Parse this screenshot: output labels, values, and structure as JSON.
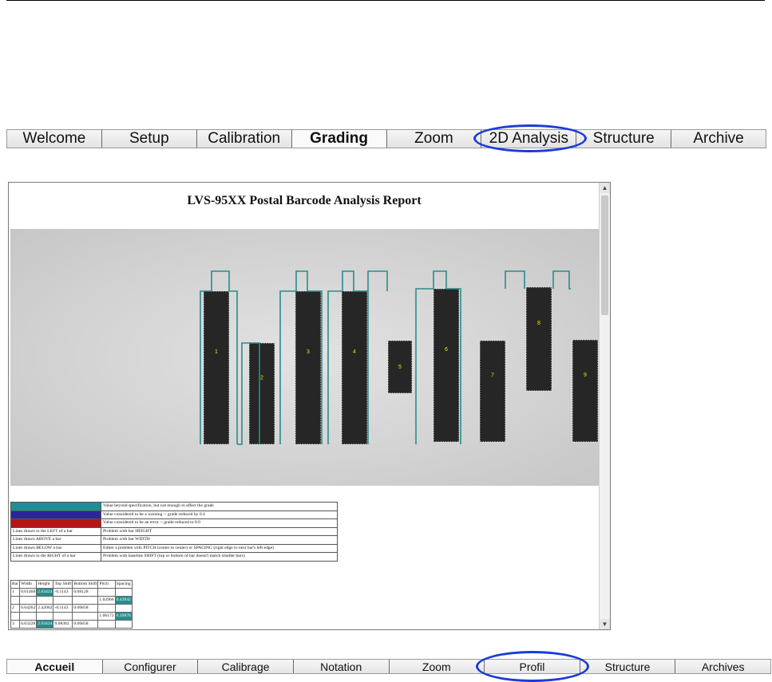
{
  "tabs_en": [
    {
      "label": "Welcome",
      "active": false
    },
    {
      "label": "Setup",
      "active": false
    },
    {
      "label": "Calibration",
      "active": false
    },
    {
      "label": "Grading",
      "active": true
    },
    {
      "label": "Zoom",
      "active": false
    },
    {
      "label": "2D Analysis",
      "active": false
    },
    {
      "label": "Structure",
      "active": false
    },
    {
      "label": "Archive",
      "active": false
    }
  ],
  "tabs_fr": [
    {
      "label": "Accueil",
      "active": true
    },
    {
      "label": "Configurer",
      "active": false
    },
    {
      "label": "Calibrage",
      "active": false
    },
    {
      "label": "Notation",
      "active": false
    },
    {
      "label": "Zoom",
      "active": false
    },
    {
      "label": "Profil",
      "active": false
    },
    {
      "label": "Structure",
      "active": false
    },
    {
      "label": "Archives",
      "active": false
    }
  ],
  "report": {
    "title": "LVS-95XX Postal Barcode Analysis Report",
    "bars": [
      "1",
      "2",
      "3",
      "4",
      "5",
      "6",
      "7",
      "8",
      "9"
    ],
    "legend": [
      {
        "swatch": "#1f8f93",
        "text": "Value beyond specification, but not enough to affect the grade"
      },
      {
        "swatch": "#27279a",
        "text": "Value considered to be a warning -- grade reduced by 0.4"
      },
      {
        "swatch": "#b81414",
        "text": "Value considered to be an error -- grade reduced to 0.0"
      },
      {
        "label": "Lines drawn to the LEFT of a bar",
        "text": "Problem with bar HEIGHT"
      },
      {
        "label": "Lines drawn ABOVE a bar",
        "text": "Problem with bar WIDTH"
      },
      {
        "label": "Lines drawn BELOW a bar",
        "text": "Either a problem with PITCH (center to center) or SPACING (right edge to next bar's left edge)"
      },
      {
        "label": "Lines drawn to the RIGHT of a bar",
        "text": "Problem with baseline SHIFT (top or bottom of bar doesn't match smaller bars)"
      }
    ],
    "table": {
      "headers": [
        "Bar",
        "Width",
        "Height",
        "Top Shift",
        "Bottom Shift",
        "Pitch",
        "Spacing"
      ],
      "rows": [
        [
          "1",
          "0.61468",
          "2.63424",
          "-0.1143",
          "0.08128",
          "",
          ""
        ],
        [
          "",
          "",
          "",
          "",
          "",
          "1.03966",
          "0.43942"
        ],
        [
          "2",
          "0.64262",
          "2.42062",
          "-0.1143",
          "0.06858",
          "",
          ""
        ],
        [
          "",
          "",
          "",
          "",
          "",
          "1.06172",
          "0.39878"
        ],
        [
          "3",
          "0.63228",
          "2.63424",
          "0.08382",
          "0.06858",
          "",
          ""
        ]
      ],
      "highlight": [
        [
          0,
          2
        ],
        [
          1,
          6
        ],
        [
          3,
          6
        ],
        [
          4,
          2
        ]
      ]
    }
  },
  "colors": {
    "outline": "#2a8c8c",
    "ellipse": "#1a3cd8",
    "bar_label": "#f2e600"
  }
}
